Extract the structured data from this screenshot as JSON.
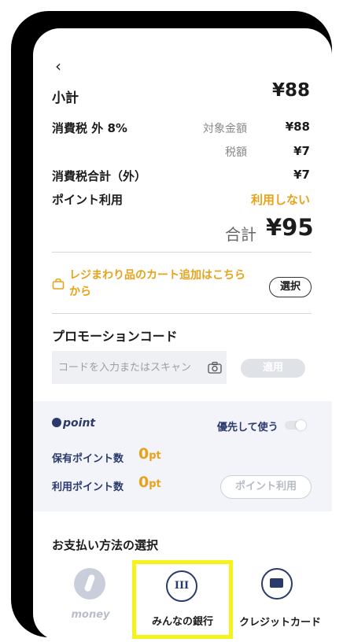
{
  "nav": {
    "back_icon": "chevron-left-icon",
    "back_glyph": "‹"
  },
  "summary": {
    "subtotal_label": "小計",
    "subtotal_value": "¥88",
    "tax_label": "消費税 外 8%",
    "taxable_label": "対象金額",
    "taxable_value": "¥88",
    "tax_amount_label": "税額",
    "tax_amount_value": "¥7",
    "tax_total_label": "消費税合計（外）",
    "tax_total_value": "¥7",
    "points_use_label": "ポイント利用",
    "points_use_value": "利用しない",
    "total_label": "合計",
    "total_value": "¥95"
  },
  "cart_addon": {
    "text": "レジまわり品のカート追加はこちらから",
    "button": "選択",
    "icon": "shopping-bag-icon"
  },
  "promo": {
    "title": "プロモーションコード",
    "placeholder": "コードを入力またはスキャン",
    "apply_button": "適用",
    "icon": "camera-icon"
  },
  "points": {
    "logo": "point",
    "priority_label": "優先して使う",
    "priority_enabled": false,
    "held_label": "保有ポイント数",
    "held_value": "0",
    "held_unit": "pt",
    "use_label": "利用ポイント数",
    "use_value": "0",
    "use_unit": "pt",
    "use_button": "ポイント利用"
  },
  "payment": {
    "title": "お支払い方法の選択",
    "methods": [
      {
        "label": "money",
        "icon": "money-flame-icon",
        "selected": false
      },
      {
        "label": "みんなの銀行",
        "icon": "bank-logo-icon",
        "icon_text": "III",
        "selected": true
      },
      {
        "label": "クレジットカード",
        "icon": "credit-card-icon",
        "selected": false
      }
    ]
  },
  "colors": {
    "accent": "#e8a21a",
    "navy": "#2a3a6a",
    "highlight": "#f4f41a"
  }
}
